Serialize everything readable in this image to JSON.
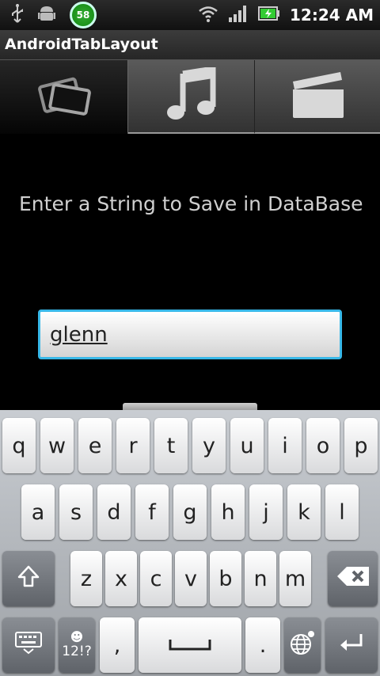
{
  "status_bar": {
    "battery_indicator": "58",
    "time": "12:24 AM",
    "icons": [
      "usb-icon",
      "android-debug-icon",
      "wifi-icon",
      "signal-icon",
      "battery-charging-icon"
    ]
  },
  "app": {
    "title": "AndroidTabLayout"
  },
  "tabs": [
    {
      "icon": "photos-icon",
      "selected": true
    },
    {
      "icon": "music-note-icon",
      "selected": false
    },
    {
      "icon": "clapperboard-icon",
      "selected": false
    }
  ],
  "form": {
    "prompt": "Enter a String to Save in DataBase",
    "input_value": "glenn"
  },
  "keyboard": {
    "row1": [
      "q",
      "w",
      "e",
      "r",
      "t",
      "y",
      "u",
      "i",
      "o",
      "p"
    ],
    "row2": [
      "a",
      "s",
      "d",
      "f",
      "g",
      "h",
      "j",
      "k",
      "l"
    ],
    "row3": [
      "z",
      "x",
      "c",
      "v",
      "b",
      "n",
      "m"
    ],
    "symbols_label": "12!?",
    "comma": ",",
    "period": "."
  },
  "colors": {
    "input_focus": "#38b8e8"
  }
}
